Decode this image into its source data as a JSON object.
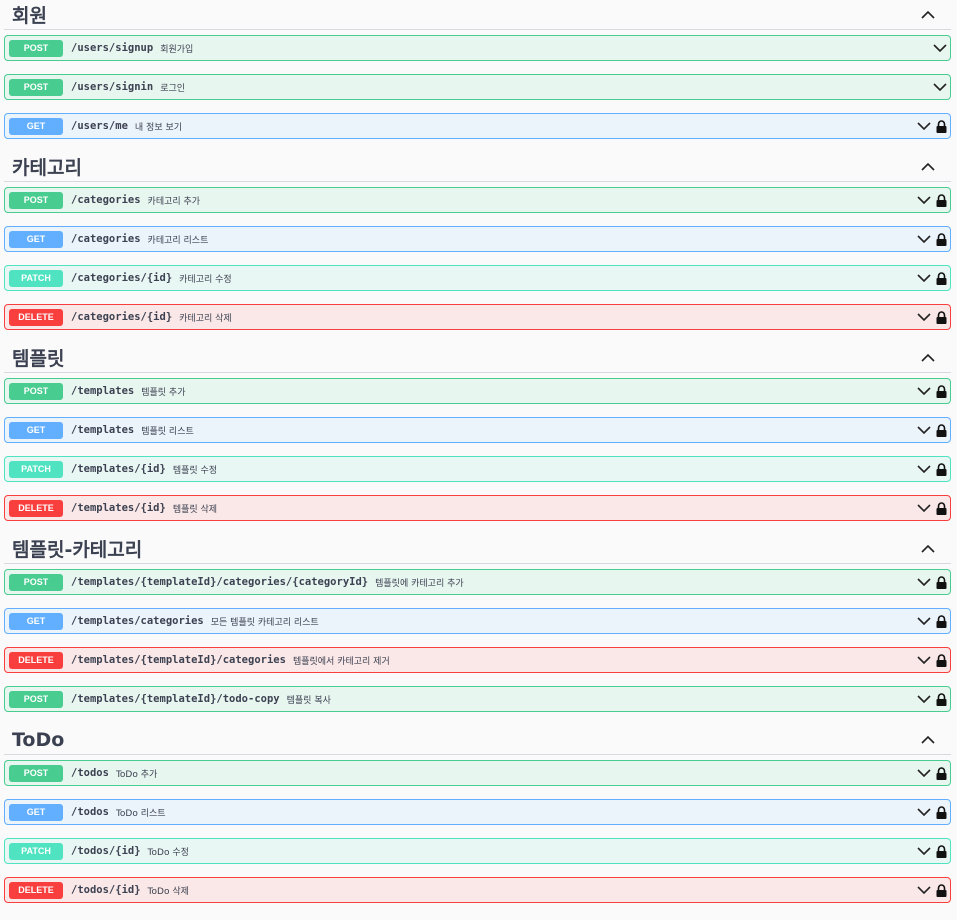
{
  "sections": [
    {
      "title": "회원",
      "ops": [
        {
          "method": "POST",
          "path": "/users/signup",
          "summary": "회원가입",
          "locked": false
        },
        {
          "method": "POST",
          "path": "/users/signin",
          "summary": "로그인",
          "locked": false
        },
        {
          "method": "GET",
          "path": "/users/me",
          "summary": "내 정보 보기",
          "locked": true
        }
      ]
    },
    {
      "title": "카테고리",
      "ops": [
        {
          "method": "POST",
          "path": "/categories",
          "summary": "카테고리 추가",
          "locked": true
        },
        {
          "method": "GET",
          "path": "/categories",
          "summary": "카테고리 리스트",
          "locked": true
        },
        {
          "method": "PATCH",
          "path": "/categories/{id}",
          "summary": "카테고리 수정",
          "locked": true
        },
        {
          "method": "DELETE",
          "path": "/categories/{id}",
          "summary": "카테고리 삭제",
          "locked": true
        }
      ]
    },
    {
      "title": "템플릿",
      "ops": [
        {
          "method": "POST",
          "path": "/templates",
          "summary": "템플릿 추가",
          "locked": true
        },
        {
          "method": "GET",
          "path": "/templates",
          "summary": "템플릿 리스트",
          "locked": true
        },
        {
          "method": "PATCH",
          "path": "/templates/{id}",
          "summary": "템플릿 수정",
          "locked": true
        },
        {
          "method": "DELETE",
          "path": "/templates/{id}",
          "summary": "템플릿 삭제",
          "locked": true
        }
      ]
    },
    {
      "title": "템플릿-카테고리",
      "ops": [
        {
          "method": "POST",
          "path": "/templates/{templateId}/categories/{categoryId}",
          "summary": "템플릿에 카테고리 추가",
          "locked": true
        },
        {
          "method": "GET",
          "path": "/templates/categories",
          "summary": "모든 템플릿 카테고리 리스트",
          "locked": true
        },
        {
          "method": "DELETE",
          "path": "/templates/{templateId}/categories",
          "summary": "템플릿에서 카테고리 제거",
          "locked": true
        },
        {
          "method": "POST",
          "path": "/templates/{templateId}/todo-copy",
          "summary": "템플릿 복사",
          "locked": true
        }
      ]
    },
    {
      "title": "ToDo",
      "ops": [
        {
          "method": "POST",
          "path": "/todos",
          "summary": "ToDo 추가",
          "locked": true
        },
        {
          "method": "GET",
          "path": "/todos",
          "summary": "ToDo 리스트",
          "locked": true
        },
        {
          "method": "PATCH",
          "path": "/todos/{id}",
          "summary": "ToDo 수정",
          "locked": true
        },
        {
          "method": "DELETE",
          "path": "/todos/{id}",
          "summary": "ToDo 삭제",
          "locked": true
        }
      ]
    }
  ],
  "icons": {
    "collapse": "chevron-up-icon",
    "expand": "chevron-down-icon",
    "lock": "lock-icon"
  },
  "colors": {
    "post": "#49cc90",
    "get": "#61affe",
    "patch": "#50e3c2",
    "delete": "#f93e3e"
  }
}
